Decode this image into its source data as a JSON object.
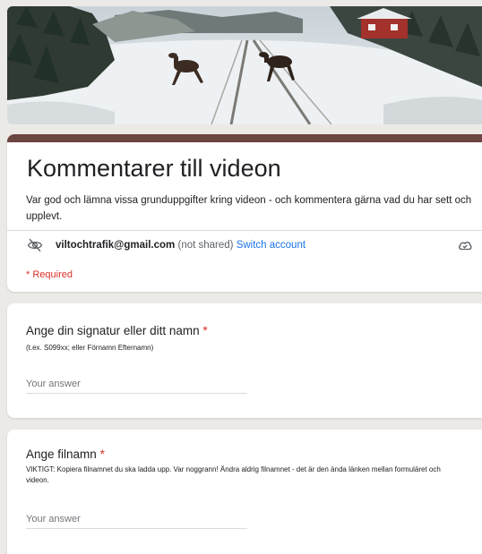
{
  "header_image": {
    "description_icon": "moose-on-railway-banner"
  },
  "form": {
    "title": "Kommentarer till videon",
    "description": "Var god och lämna vissa grunduppgifter kring videon - och kommentera gärna vad du har sett och upplevt.",
    "account": {
      "email": "viltochtrafik@gmail.com",
      "not_shared": "(not shared)",
      "switch_label": "Switch account"
    },
    "required_note": "* Required"
  },
  "questions": [
    {
      "title": "Ange din signatur eller ditt namn",
      "star": "*",
      "help": "(t.ex. S099xx; eller Förnamn Efternamn)",
      "placeholder": "Your answer"
    },
    {
      "title": "Ange filnamn",
      "star": "*",
      "help": "VIKTIGT: Kopiera filnamnet du ska ladda upp. Var noggrann! Ändra aldrig filnamnet - det är den ända länken mellan formuläret och videon.",
      "placeholder": "Your answer"
    }
  ],
  "colors": {
    "accent": "#6b4540",
    "required": "#d93025",
    "link": "#1a73e8"
  }
}
